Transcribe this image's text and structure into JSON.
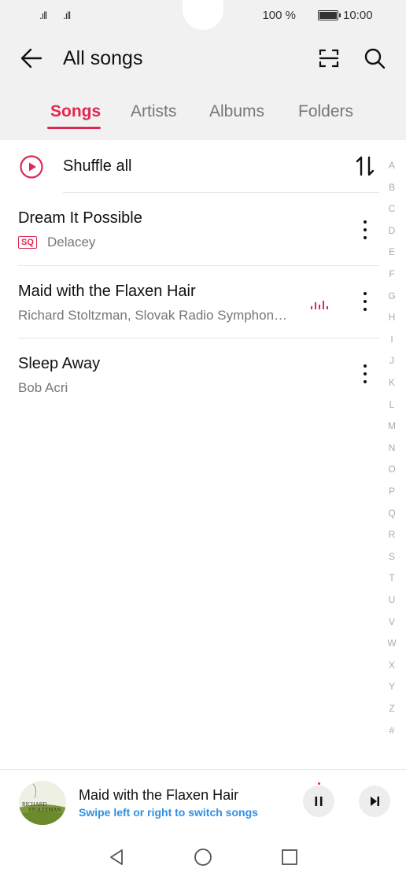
{
  "status_bar": {
    "signal1": ".ıll",
    "signal2": ".ıll",
    "battery_text": "100 %",
    "time": "10:00"
  },
  "header": {
    "title": "All songs",
    "tabs": [
      "Songs",
      "Artists",
      "Albums",
      "Folders"
    ],
    "active_tab": "Songs"
  },
  "shuffle": {
    "label": "Shuffle all"
  },
  "songs": [
    {
      "title": "Dream It Possible",
      "badge": "SQ",
      "artist": "Delacey"
    },
    {
      "title": "Maid with the Flaxen Hair",
      "artist": "Richard Stoltzman, Slovak Radio Symphon…",
      "playing": true
    },
    {
      "title": "Sleep Away",
      "artist": "Bob Acri"
    }
  ],
  "alphabet": [
    "A",
    "B",
    "C",
    "D",
    "E",
    "F",
    "G",
    "H",
    "I",
    "J",
    "K",
    "L",
    "M",
    "N",
    "O",
    "P",
    "Q",
    "R",
    "S",
    "T",
    "U",
    "V",
    "W",
    "X",
    "Y",
    "Z",
    "#"
  ],
  "player": {
    "cover_text_line1": "RICHARD",
    "cover_text_line2": "STOLTZMAN",
    "title": "Maid with the Flaxen Hair",
    "hint": "Swipe left or right to switch songs"
  },
  "colors": {
    "accent": "#e0284f",
    "hint_blue": "#2f8fe6"
  }
}
